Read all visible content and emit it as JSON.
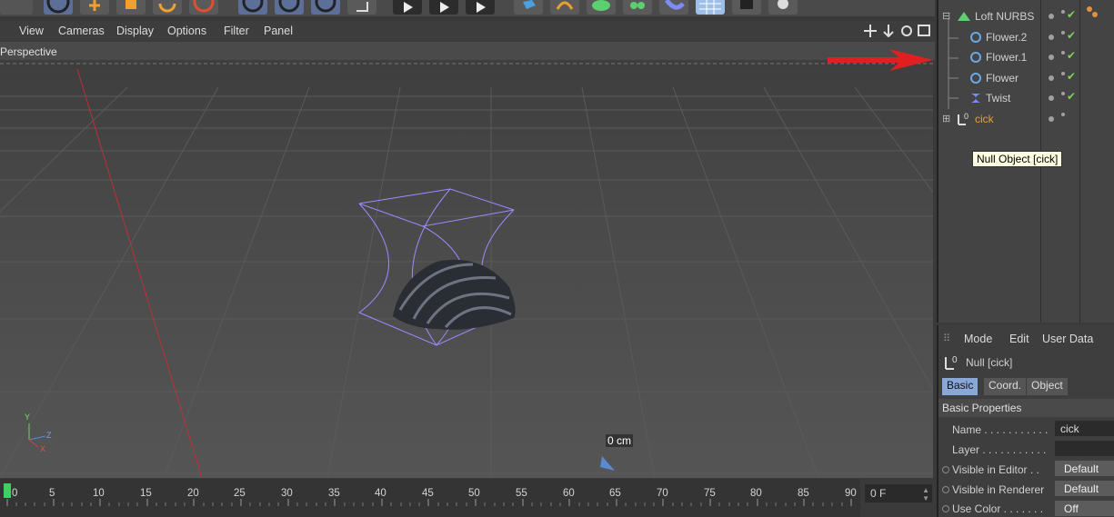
{
  "viewport_menu": [
    "View",
    "Cameras",
    "Display",
    "Options",
    "Filter",
    "Panel"
  ],
  "viewport_label": "Perspective",
  "axis_labels": {
    "y": "Y",
    "z": "Z",
    "x": "X"
  },
  "distance_label": "0 cm",
  "object_manager": {
    "rows": [
      {
        "name": "Loft NURBS",
        "icon": "loft-nurbs-icon"
      },
      {
        "name": "Flower.2",
        "icon": "flower-spline-icon"
      },
      {
        "name": "Flower.1",
        "icon": "flower-spline-icon"
      },
      {
        "name": "Flower",
        "icon": "flower-spline-icon"
      },
      {
        "name": "Twist",
        "icon": "twist-deformer-icon"
      },
      {
        "name": "cick",
        "icon": "null-object-icon"
      }
    ],
    "tooltip": "Null Object [cick]"
  },
  "attributes": {
    "menu": [
      "Mode",
      "Edit",
      "User Data"
    ],
    "object_title": "Null [cick]",
    "tabs": [
      "Basic",
      "Coord.",
      "Object"
    ],
    "section": "Basic Properties",
    "props": [
      {
        "label": "Name . . . . . . . . . . .",
        "value": "cick"
      },
      {
        "label": "Layer . . . . . . . . . . .",
        "value": ""
      },
      {
        "label": "Visible in Editor . .",
        "value": "Default"
      },
      {
        "label": "Visible in Renderer",
        "value": "Default"
      },
      {
        "label": "Use Color . . . . . . .",
        "value": "Off"
      }
    ]
  },
  "timeline": {
    "ticks": [
      "0",
      "5",
      "10",
      "15",
      "20",
      "25",
      "30",
      "35",
      "40",
      "45",
      "50",
      "55",
      "60",
      "65",
      "70",
      "75",
      "80",
      "85",
      "90"
    ],
    "current_frame": "0 F"
  },
  "colors": {
    "arrow": "#e02020",
    "selection": "#9b8cff",
    "accent": "#8aa7d8"
  }
}
